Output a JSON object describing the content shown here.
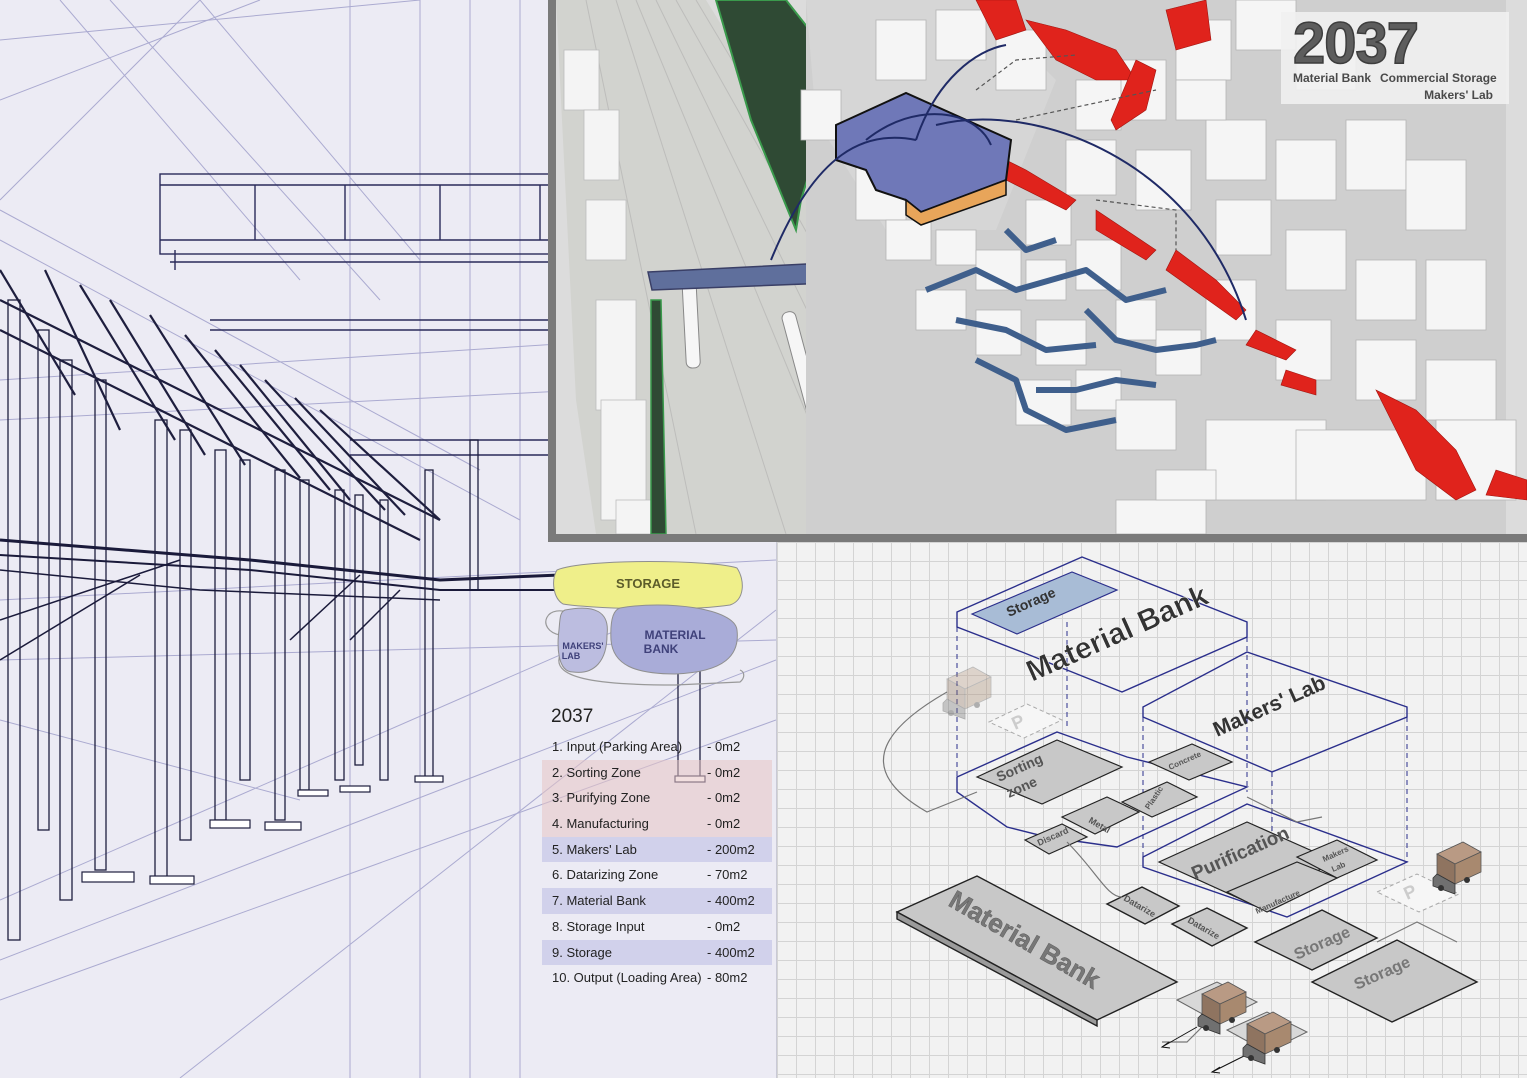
{
  "header": {
    "year": "2037",
    "subtitle_line1a": "Material Bank",
    "subtitle_line1b": "Commercial Storage",
    "subtitle_line2": "Makers' Lab"
  },
  "bubble_diagram": {
    "storage": "STORAGE",
    "material_bank_line1": "MATERIAL",
    "material_bank_line2": "BANK",
    "makers_lab_line1": "MAKERS'",
    "makers_lab_line2": "LAB"
  },
  "area_table": {
    "year": "2037",
    "rows": [
      {
        "name": "1. Input (Parking Area)",
        "value": "-  0m2",
        "band": "none"
      },
      {
        "name": "2. Sorting Zone",
        "value": "-  0m2",
        "band": "pink"
      },
      {
        "name": "3. Purifying Zone",
        "value": "-  0m2",
        "band": "pink"
      },
      {
        "name": "4. Manufacturing",
        "value": "-  0m2",
        "band": "pink"
      },
      {
        "name": "5. Makers' Lab",
        "value": "-  200m2",
        "band": "lav"
      },
      {
        "name": "6. Datarizing Zone",
        "value": "-  70m2",
        "band": "none"
      },
      {
        "name": "7. Material Bank",
        "value": "-  400m2",
        "band": "lav"
      },
      {
        "name": "8. Storage Input",
        "value": "-  0m2",
        "band": "none"
      },
      {
        "name": "9. Storage",
        "value": "-  400m2",
        "band": "lav"
      },
      {
        "name": "10. Output (Loading Area)",
        "value": "-  80m2",
        "band": "none"
      }
    ]
  },
  "iso_labels": {
    "storage_top": "Storage",
    "material_bank_top": "Material Bank",
    "makers_lab_top": "Makers' Lab",
    "sorting_line1": "Sorting",
    "sorting_line2": "zone",
    "concrete": "Concrete",
    "plastic": "Plastic",
    "metal": "Metal",
    "discard": "Discard",
    "purification": "Purification",
    "makers_lab_small_line1": "Makers",
    "makers_lab_small_line2": "Lab",
    "manufacture": "Manufacture",
    "datarize1": "Datarize",
    "datarize2": "Datarize",
    "material_bank_base": "Material Bank",
    "storage_base1": "Storage",
    "storage_base2": "Storage",
    "parking1": "P",
    "parking2": "P"
  },
  "colors": {
    "accent_red": "#e0231c",
    "accent_blue": "#3f5f8c",
    "building_purple": "#6f78b8",
    "building_orange": "#e8a55a",
    "storage_yellow": "#efef8a",
    "bubble_lavender": "#a9acd8",
    "iso_line": "#2b2f8c",
    "green_buffer": "#2d5a36"
  }
}
